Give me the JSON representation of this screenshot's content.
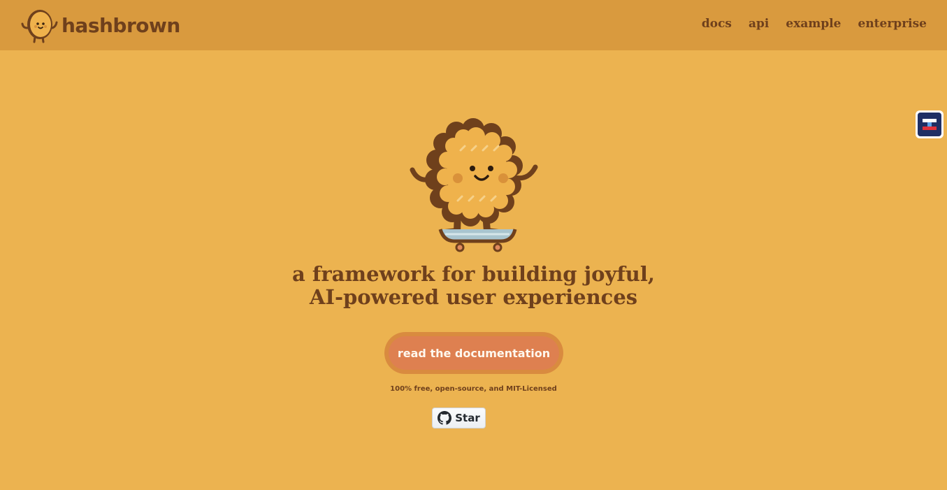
{
  "header": {
    "brand_name": "hashbrown",
    "nav": [
      {
        "label": "docs"
      },
      {
        "label": "api"
      },
      {
        "label": "example"
      },
      {
        "label": "enterprise"
      }
    ]
  },
  "hero": {
    "headline_line1": "a framework for building joyful,",
    "headline_line2": "AI-powered user experiences",
    "cta_label": "read the documentation",
    "license_note": "100% free, open-source, and MIT-Licensed",
    "github_star_label": "Star"
  },
  "icons": {
    "brand_logo": "hashbrown-mascot-icon",
    "hero_mascot": "hashbrown-skateboard-mascot",
    "github": "github-icon",
    "extension": "browser-extension-icon"
  },
  "colors": {
    "background": "#ecb350",
    "header_background": "#d99a3e",
    "text_brown": "#6f401c",
    "cta": "#de8050"
  }
}
